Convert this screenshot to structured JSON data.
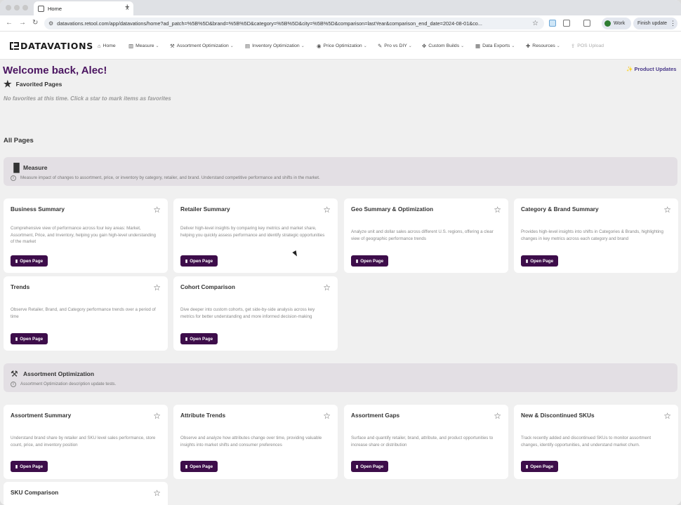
{
  "browser": {
    "tab_title": "Home",
    "tab_close": "×",
    "new_tab": "+",
    "back": "←",
    "forward": "→",
    "reload": "↻",
    "url": "datavations.retool.com/app/datavations/home?ad_patch=%5B%5D&brand=%5B%5D&category=%5B%5D&city=%5B%5D&comparison=lastYear&comparison_end_date=2024-08-01&co...",
    "bookmark_star": "☆",
    "profile_label": "Work",
    "finish_update_label": "Finish update",
    "menu_glyph": "⋮"
  },
  "nav": {
    "logo": "DATAVATIONS",
    "items": [
      {
        "label": "Home",
        "icon": "home-icon",
        "glyph": "⌂",
        "chevron": ""
      },
      {
        "label": "Measure",
        "icon": "bar-chart-icon",
        "glyph": "▥",
        "chevron": "⌄"
      },
      {
        "label": "Assortment Optimization",
        "icon": "hammer-icon",
        "glyph": "⚒",
        "chevron": "⌄"
      },
      {
        "label": "Inventory Optimization",
        "icon": "inventory-icon",
        "glyph": "▤",
        "chevron": "⌄"
      },
      {
        "label": "Price Optimization",
        "icon": "dollar-icon",
        "glyph": "◉",
        "chevron": "⌄"
      },
      {
        "label": "Pro vs DIY",
        "icon": "pen-icon",
        "glyph": "✎",
        "chevron": "⌄"
      },
      {
        "label": "Custom Builds",
        "icon": "puzzle-icon",
        "glyph": "✥",
        "chevron": "⌄"
      },
      {
        "label": "Data Exports",
        "icon": "calendar-icon",
        "glyph": "▦",
        "chevron": "⌄"
      },
      {
        "label": "Resources",
        "icon": "plus-icon",
        "glyph": "✚",
        "chevron": "⌄"
      },
      {
        "label": "POS Upload",
        "icon": "upload-icon",
        "glyph": "⇪",
        "chevron": ""
      }
    ]
  },
  "main": {
    "welcome": "Welcome back, Alec!",
    "product_updates": "Product Updates",
    "product_updates_glyph": "✨",
    "favorites_title": "Favorited Pages",
    "favorites_glyph": "★",
    "no_favorites": "No favorites at this time. Click a star to mark items as favorites",
    "all_pages": "All Pages"
  },
  "sections": [
    {
      "title": "Measure",
      "icon": "bar-chart-icon",
      "glyph": "▐▌",
      "description": "Measure impact of changes to assortment, price, or inventory by category, retailer, and brand. Understand competitive performance and shifts in the market.",
      "cards": [
        {
          "title": "Business Summary",
          "description": "Comprehensive view of performance across four key areas: Market, Assortment, Price, and Inventory, helping you gain high-level understanding of the market"
        },
        {
          "title": "Retailer Summary",
          "description": "Deliver high-level insights by comparing key metrics and market share, helping you quickly assess performance and identify strategic opportunities"
        },
        {
          "title": "Geo Summary & Optimization",
          "description": "Analyze unit and dollar sales across different U.S. regions, offering a clear view of geographic performance trends"
        },
        {
          "title": "Category & Brand Summary",
          "description": "Provides high-level insights into shifts in Categories & Brands, highlighting changes in key metrics across each category and brand"
        },
        {
          "title": "Trends",
          "description": "Observe Retailer, Brand, and Category performance trends over a period of time"
        },
        {
          "title": "Cohort Comparison",
          "description": "Dive deeper into custom cohorts, get side-by-side analysis across key metrics for better understanding and more informed decision-making"
        }
      ]
    },
    {
      "title": "Assortment Optimization",
      "icon": "hammer-icon",
      "glyph": "⚒",
      "description": "Assortment Optimization description update tests.",
      "cards": [
        {
          "title": "Assortment Summary",
          "description": "Understand brand share by retailer and SKU level sales performance, store count, price, and inventory position"
        },
        {
          "title": "Attribute Trends",
          "description": "Observe and analyze how attributes change over time, providing valuable insights into market shifts and consumer preferences"
        },
        {
          "title": "Assortment Gaps",
          "description": "Surface and quantify retailer, brand, attribute, and product opportunities to increase share or distribution"
        },
        {
          "title": "New & Discontinued SKUs",
          "description": "Track recently added and discontinued SKUs to monitor assortment changes, identify opportunities, and understand market churn."
        },
        {
          "title": "SKU Comparison",
          "description": ""
        }
      ]
    }
  ],
  "card_common": {
    "open_label": "Open Page",
    "open_glyph": "▮",
    "star_glyph": "☆",
    "info_glyph": "i"
  },
  "colors": {
    "brand": "#4a1460",
    "button": "#3d0d4a",
    "section_bg": "#e3dfe4",
    "page_bg": "#f0f0f0"
  }
}
